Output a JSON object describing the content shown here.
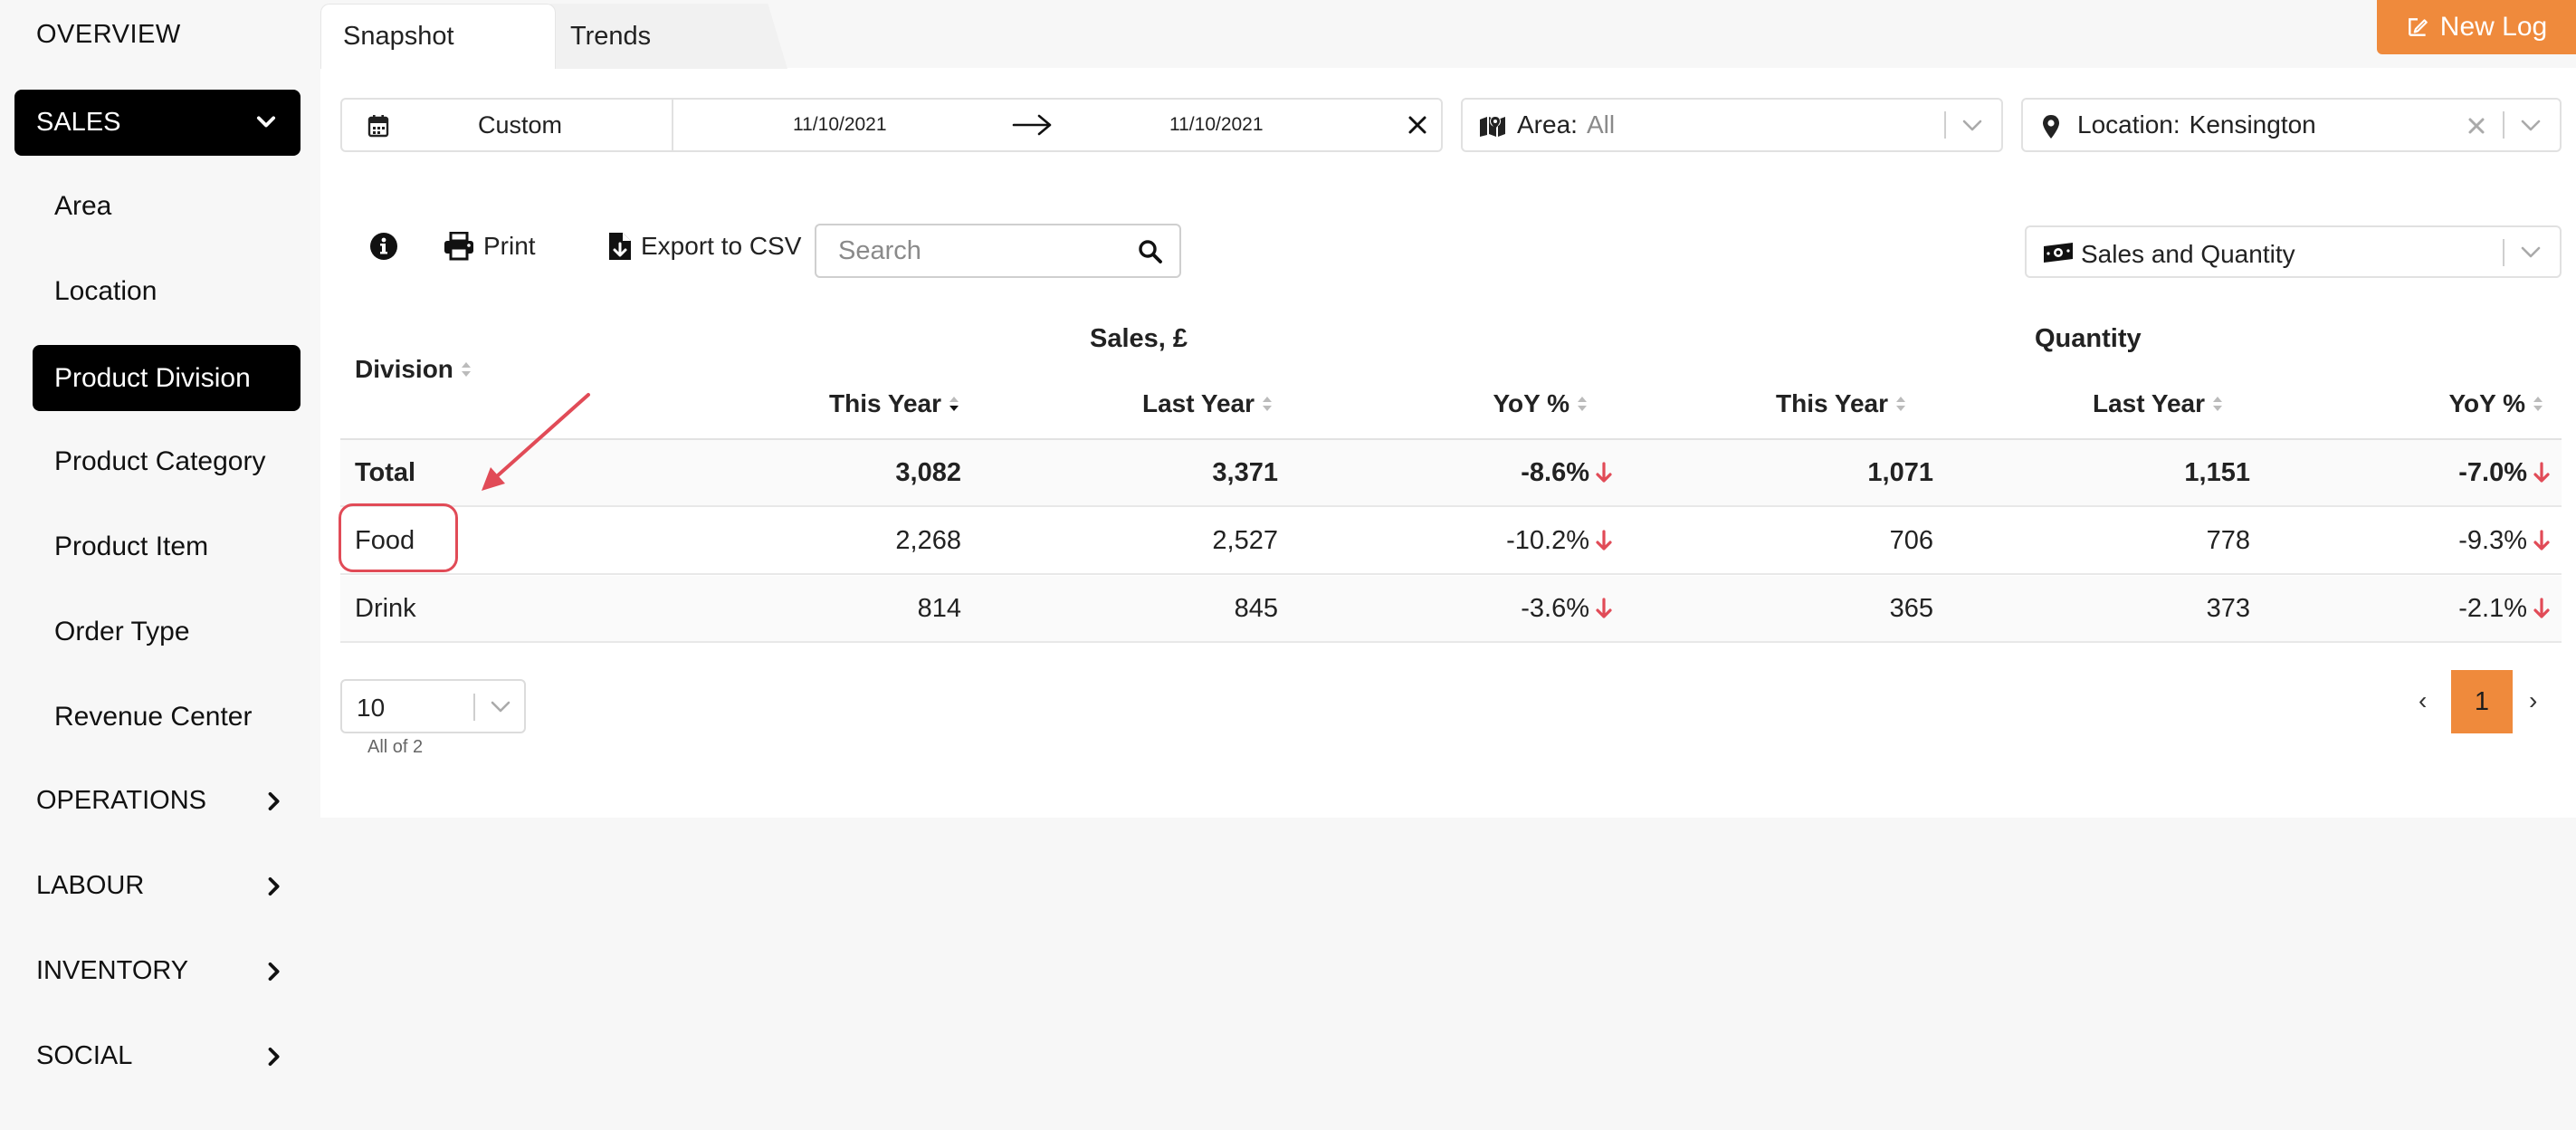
{
  "sidebar": {
    "overview": "OVERVIEW",
    "sales": "SALES",
    "sales_items": [
      "Area",
      "Location",
      "Product Division",
      "Product Category",
      "Product Item",
      "Order Type",
      "Revenue Center"
    ],
    "active_item": "Product Division",
    "sections": [
      "OPERATIONS",
      "LABOUR",
      "INVENTORY",
      "SOCIAL"
    ]
  },
  "tabs": {
    "snapshot": "Snapshot",
    "trends": "Trends"
  },
  "new_log": "New Log",
  "filters": {
    "period": "Custom",
    "date_from": "11/10/2021",
    "date_to": "11/10/2021",
    "area_label": "Area:",
    "area_value": "All",
    "location_label": "Location:",
    "location_value": "Kensington"
  },
  "toolbar": {
    "print": "Print",
    "export": "Export to CSV",
    "search_placeholder": "Search",
    "metric": "Sales and Quantity"
  },
  "table": {
    "group_sales": "Sales, £",
    "group_quantity": "Quantity",
    "columns": {
      "division": "Division",
      "sales_this_year": "This Year",
      "sales_last_year": "Last Year",
      "sales_yoy": "YoY %",
      "qty_this_year": "This Year",
      "qty_last_year": "Last Year",
      "qty_yoy": "YoY %"
    },
    "rows": [
      {
        "division": "Total",
        "sales_this_year": "3,082",
        "sales_last_year": "3,371",
        "sales_yoy": "-8.6%",
        "qty_this_year": "1,071",
        "qty_last_year": "1,151",
        "qty_yoy": "-7.0%"
      },
      {
        "division": "Food",
        "sales_this_year": "2,268",
        "sales_last_year": "2,527",
        "sales_yoy": "-10.2%",
        "qty_this_year": "706",
        "qty_last_year": "778",
        "qty_yoy": "-9.3%"
      },
      {
        "division": "Drink",
        "sales_this_year": "814",
        "sales_last_year": "845",
        "sales_yoy": "-3.6%",
        "qty_this_year": "365",
        "qty_last_year": "373",
        "qty_yoy": "-2.1%"
      }
    ]
  },
  "pagination": {
    "page_size": "10",
    "summary": "All of 2",
    "prev": "‹",
    "current_page": "1",
    "next": "›"
  },
  "colors": {
    "accent": "#ef8a3c",
    "negative": "#e14b57",
    "annotation": "#e14b57"
  }
}
